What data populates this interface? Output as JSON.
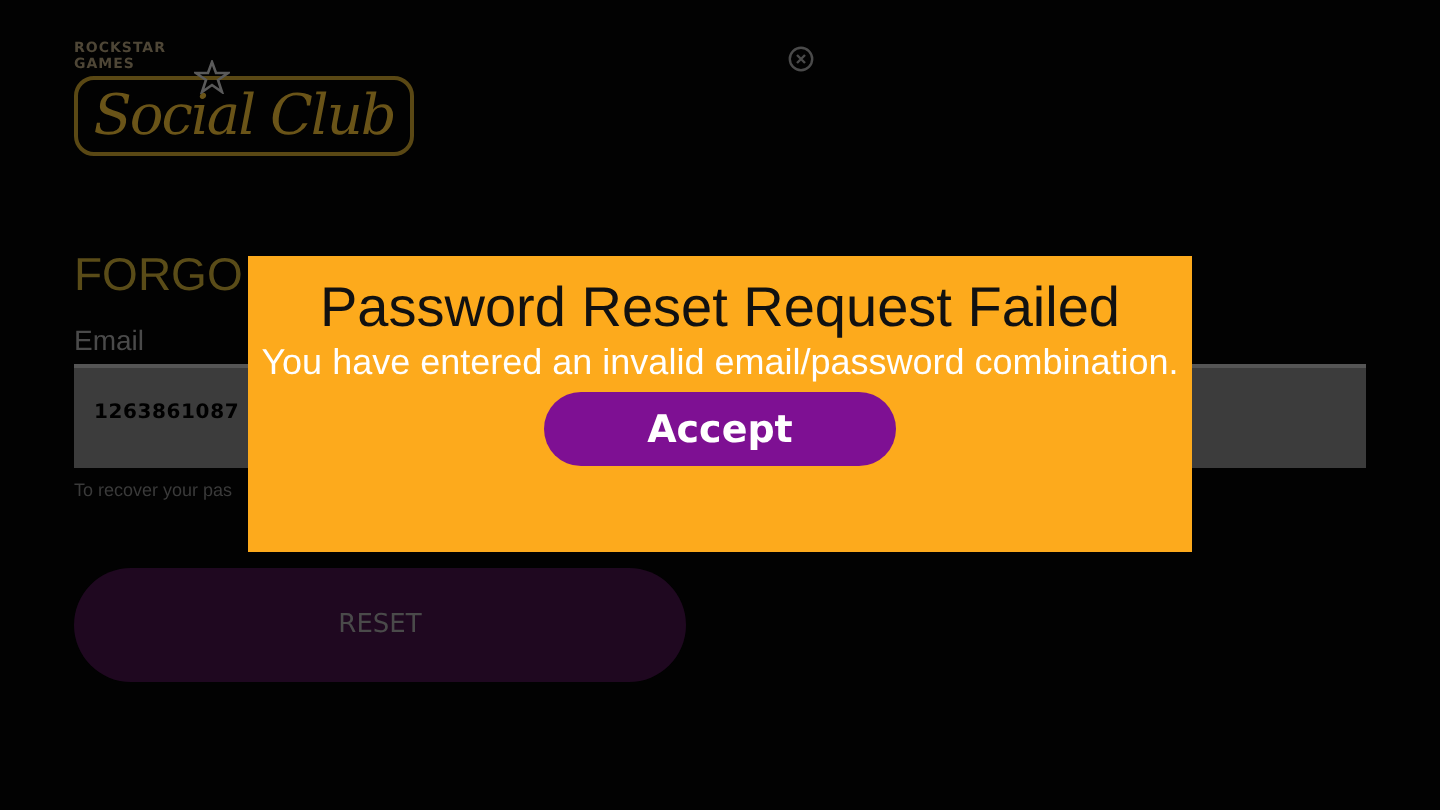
{
  "logo": {
    "publisher": "ROCKSTAR",
    "publisher_line_2": "GAMES",
    "name": "Social Club"
  },
  "page": {
    "heading": "FORGO",
    "email_label": "Email",
    "email_value": "1263861087",
    "hint": "To recover your pas",
    "reset_button": "RESET"
  },
  "dialog": {
    "title": "Password Reset Request Failed",
    "message": "You have entered an invalid email/password combination.",
    "button": "Accept"
  }
}
